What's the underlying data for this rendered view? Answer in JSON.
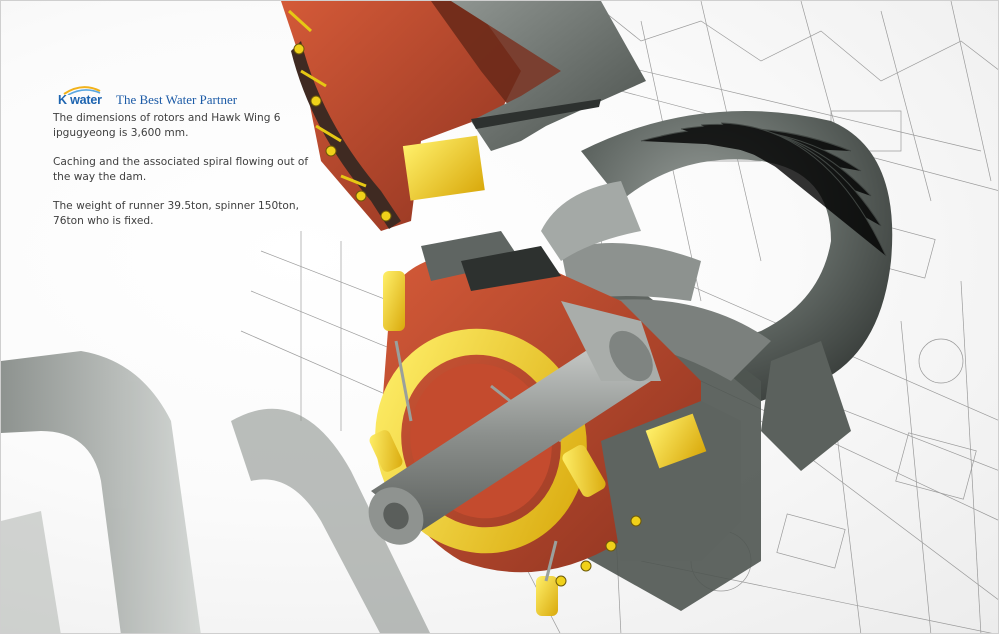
{
  "brand": {
    "logo_text": "K water",
    "tagline": "The Best Water Partner"
  },
  "description": {
    "paragraph_1": "The dimensions of rotors and Hawk Wing 6 ipgugyeong is 3,600 mm.",
    "paragraph_2": "Caching and the associated spiral flowing out of the way the dam.",
    "paragraph_3": "The weight of runner 39.5ton, spinner 150ton, 76ton who is fixed."
  },
  "colors": {
    "brand_blue": "#1d64b0",
    "logo_arc_yellow": "#f2b21a",
    "logo_arc_blue": "#5aa7e0",
    "rotor_red": "#b8462b",
    "accent_yellow": "#f0d11a",
    "casing_gray": "#5e6460"
  },
  "illustration": {
    "icon": "turbine-cutaway-illustration"
  }
}
